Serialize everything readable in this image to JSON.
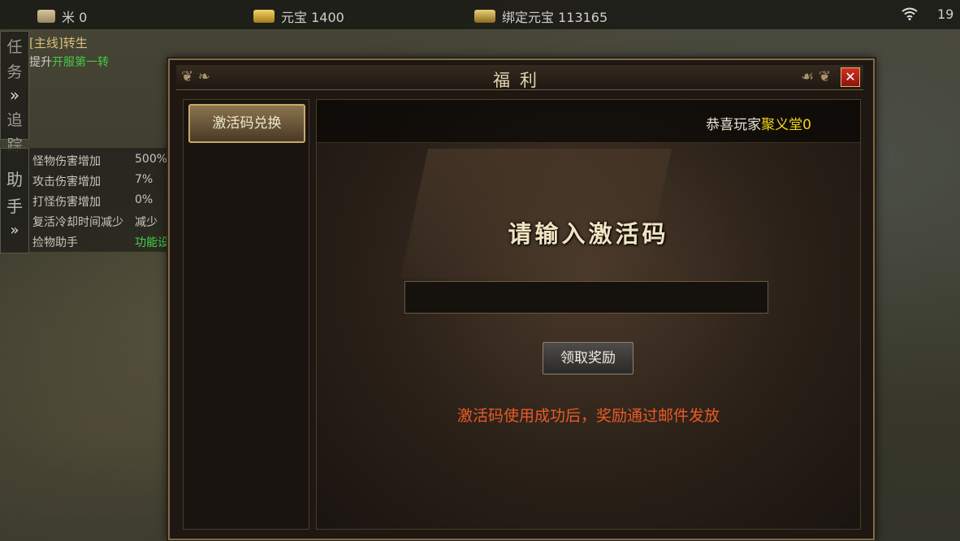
{
  "topbar": {
    "rice_label": "米 0",
    "ingot_label": "元宝 1400",
    "bound_ingot_label": "绑定元宝 113165",
    "clock": "19"
  },
  "task_panel": {
    "tab_chars": [
      "任",
      "务",
      "追",
      "踪"
    ],
    "tab_arrow": "»",
    "quest_prefix": "[主线]",
    "quest_name": "转生",
    "quest_desc_prefix": "提升",
    "quest_desc_highlight": "开服第一转"
  },
  "helper_panel": {
    "tab_chars": [
      "助",
      "手"
    ],
    "tab_arrow": "»",
    "rows": [
      {
        "label": "怪物伤害增加",
        "value": "500%"
      },
      {
        "label": "攻击伤害增加",
        "value": "7%"
      },
      {
        "label": "打怪伤害增加",
        "value": "0%"
      },
      {
        "label": "复活冷却时间减少",
        "value": "减少"
      },
      {
        "label": "捡物助手",
        "value": "功能设置"
      }
    ]
  },
  "dialog": {
    "title": "福利",
    "close_glyph": "✕",
    "tab_redeem": "激活码兑换",
    "marquee_prefix": "恭喜玩家",
    "marquee_highlight": "聚义堂0",
    "prompt": "请输入激活码",
    "input_value": "",
    "input_placeholder": "",
    "claim_button": "领取奖励",
    "notice": "激活码使用成功后，奖励通过邮件发放"
  },
  "colors": {
    "notice": "#ea5a26",
    "highlight": "#f2d51a",
    "quest_green": "#45c945"
  }
}
